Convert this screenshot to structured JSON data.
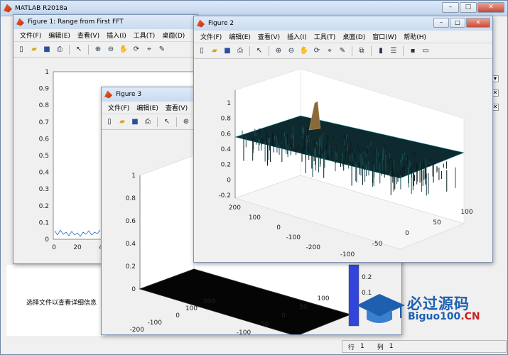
{
  "main_window": {
    "title": "MATLAB R2018a",
    "detail_text": "选择文件以查看详细信息",
    "status": {
      "row_label": "行",
      "row_value": "1",
      "col_label": "列",
      "col_value": "1"
    }
  },
  "figure1": {
    "title": "Figure 1: Range from First FFT",
    "menu": [
      "文件(F)",
      "编辑(E)",
      "查看(V)",
      "插入(I)",
      "工具(T)",
      "桌面(D)"
    ],
    "y_ticks": [
      "1",
      "0.9",
      "0.8",
      "0.7",
      "0.6",
      "0.5",
      "0.4",
      "0.3",
      "0.2",
      "0.1",
      "0"
    ],
    "x_ticks": [
      "0",
      "20",
      "4"
    ]
  },
  "figure3": {
    "title": "Figure 3",
    "menu": [
      "文件(F)",
      "编辑(E)",
      "查看(V)"
    ],
    "z_ticks": [
      "1",
      "0.8",
      "0.6",
      "0.4",
      "0.2",
      "0"
    ],
    "y_ticks": [
      "200",
      "100",
      "0",
      "-100",
      "-200"
    ],
    "x_ticks": [
      "-100",
      "-50",
      "0",
      "50",
      "100"
    ],
    "colorbar_ticks": [
      "0.2",
      "0.1"
    ]
  },
  "figure2": {
    "title": "Figure 2",
    "menu": [
      "文件(F)",
      "编辑(E)",
      "查看(V)",
      "插入(I)",
      "工具(T)",
      "桌面(D)",
      "窗口(W)",
      "帮助(H)"
    ],
    "z_ticks": [
      "1",
      "0.8",
      "0.6",
      "0.4",
      "0.2",
      "0",
      "-0.2"
    ],
    "y_ticks": [
      "200",
      "100",
      "0",
      "-100",
      "-200"
    ],
    "x_ticks": [
      "-100",
      "-50",
      "0",
      "50",
      "100"
    ]
  },
  "watermark": {
    "cn": "必过源码",
    "en": "Biguo100",
    "en_suffix": ".CN"
  },
  "colors": {
    "surface": "#0f2a2e",
    "surface_edge": "#27a7b8",
    "colorbar": "#3344dd",
    "titlebar": "#c9dbf0"
  }
}
